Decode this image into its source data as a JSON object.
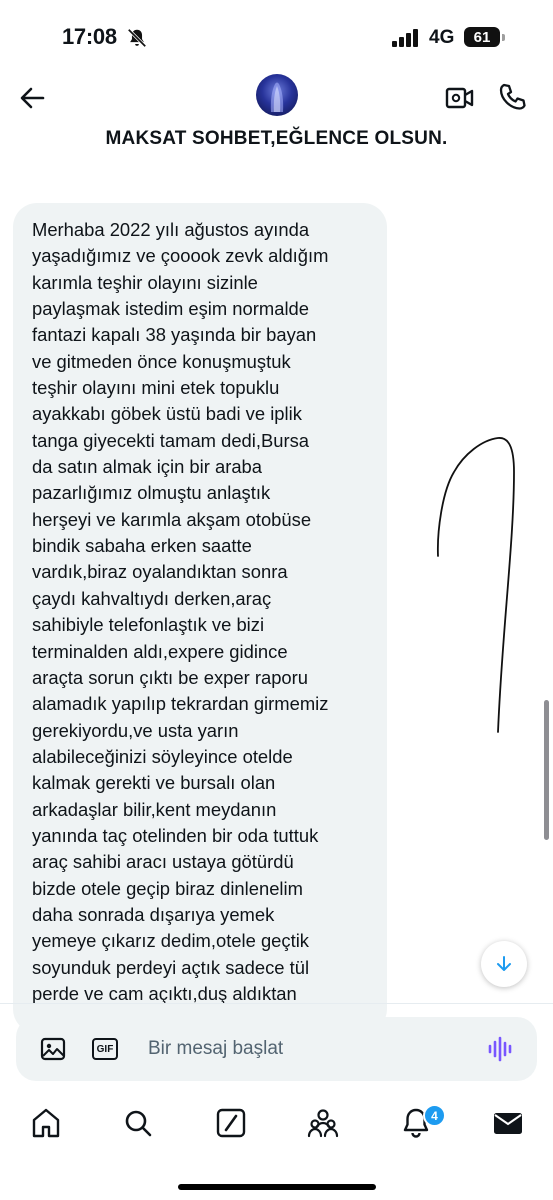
{
  "status_bar": {
    "time": "17:08",
    "network": "4G",
    "battery": "61"
  },
  "header": {
    "title": "MAKSAT SOHBET,EĞLENCE OLSUN."
  },
  "message": {
    "text": "Merhaba 2022 yılı ağustos ayında\nyaşadığımız ve çooook zevk aldığım\nkarımla teşhir olayını sizinle\npaylaşmak istedim eşim normalde\nfantazi kapalı 38 yaşında bir bayan\nve gitmeden önce  konuşmuştuk\nteşhir olayını mini etek topuklu\nayakkabı göbek üstü badi ve  iplik\ntanga giyecekti tamam dedi,Bursa\nda satın almak için bir araba\npazarlığımız olmuştu anlaştık\nherşeyi ve karımla akşam otobüse\nbindik sabaha erken saatte\nvardık,biraz oyalandıktan sonra\nçaydı kahvaltıydı derken,araç\nsahibiyle telefonlaştık ve bizi\nterminalden aldı,expere gidince\naraçta sorun çıktı be exper raporu\nalamadık yapılıp tekrardan girmemiz\ngerekiyordu,ve usta yarın\nalabileceğinizi söyleyince otelde\nkalmak gerekti ve bursalı olan\narkadaşlar bilir,kent meydanın\nyanında taç otelinden bir oda tuttuk\naraç sahibi aracı ustaya götürdü\nbizde otele geçip biraz dinlenelim\ndaha sonrada dışarıya yemek\nyemeye çıkarız dedim,otele geçtik\nsoyunduk perdeyi açtık sadece tül\nperde ve cam açıktı,duş aldıktan"
  },
  "composer": {
    "placeholder": "Bir mesaj başlat",
    "gif_label": "GIF"
  },
  "bottom_nav": {
    "items": [
      "home",
      "search",
      "grok",
      "communities",
      "notifications",
      "messages"
    ],
    "notifications_badge": "4"
  },
  "colors": {
    "accent": "#1d9bf0",
    "bubble": "#eff3f4",
    "voice": "#7856ff"
  }
}
